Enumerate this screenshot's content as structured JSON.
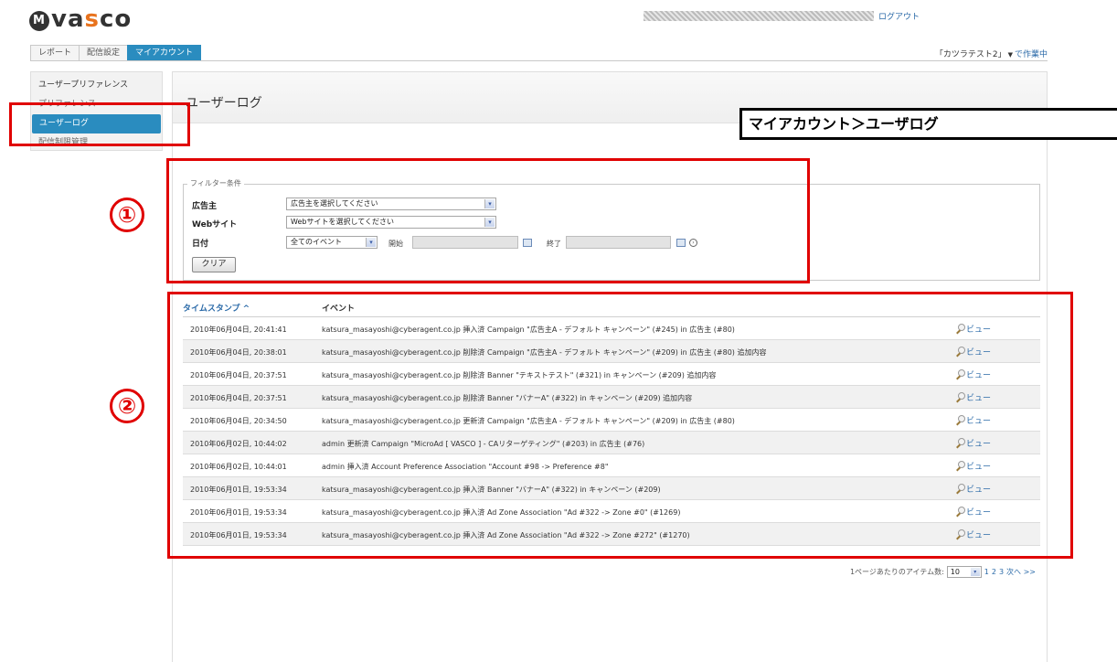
{
  "header": {
    "logo_mark": "M",
    "logo_prefix": "va",
    "logo_accent": "s",
    "logo_suffix": "co",
    "logout": "ログアウト",
    "account_name": "「カツラテスト2」",
    "account_caret": "▼",
    "working_text": "で作業中"
  },
  "tabs": [
    {
      "label": "レポート"
    },
    {
      "label": "配信設定"
    },
    {
      "label": "マイアカウント",
      "active": true
    }
  ],
  "sidebar": {
    "items": [
      {
        "label": "ユーザープリファレンス"
      },
      {
        "label": "プリファレンス"
      },
      {
        "label": "ユーザーログ",
        "active": true
      },
      {
        "label": "配信制限管理"
      }
    ]
  },
  "page": {
    "title": "ユーザーログ",
    "callout": "マイアカウント＞ユーザログ"
  },
  "annotations": {
    "marker_1": "①",
    "marker_2": "②",
    "color": "#e00000"
  },
  "filter": {
    "legend": "フィルター条件",
    "advertiser_label": "広告主",
    "advertiser_value": "広告主を選択してください",
    "website_label": "Webサイト",
    "website_value": "Webサイトを選択してください",
    "date_label": "日付",
    "date_value": "全てのイベント",
    "start_label": "開始",
    "end_label": "終了",
    "clear_button": "クリア",
    "dropdown_glyph": "▾"
  },
  "log": {
    "col_timestamp": "タイムスタンプ ^",
    "col_event": "イベント",
    "view_label": "ビュー",
    "rows": [
      {
        "timestamp": "2010年06月04日, 20:41:41",
        "event": "katsura_masayoshi@cyberagent.co.jp 挿入済 Campaign \"広告主A - デフォルト キャンペーン\" (#245) in 広告主 (#80)"
      },
      {
        "timestamp": "2010年06月04日, 20:38:01",
        "event": "katsura_masayoshi@cyberagent.co.jp 削除済 Campaign \"広告主A - デフォルト キャンペーン\" (#209) in 広告主 (#80) 追加内容"
      },
      {
        "timestamp": "2010年06月04日, 20:37:51",
        "event": "katsura_masayoshi@cyberagent.co.jp 削除済 Banner \"テキストテスト\" (#321) in キャンペーン (#209) 追加内容"
      },
      {
        "timestamp": "2010年06月04日, 20:37:51",
        "event": "katsura_masayoshi@cyberagent.co.jp 削除済 Banner \"バナーA\" (#322) in キャンペーン (#209) 追加内容"
      },
      {
        "timestamp": "2010年06月04日, 20:34:50",
        "event": "katsura_masayoshi@cyberagent.co.jp 更新済 Campaign \"広告主A - デフォルト キャンペーン\" (#209) in 広告主 (#80)"
      },
      {
        "timestamp": "2010年06月02日, 10:44:02",
        "event": "admin 更新済 Campaign \"MicroAd [ VASCO ] - CAリターゲティング\" (#203) in 広告主 (#76)"
      },
      {
        "timestamp": "2010年06月02日, 10:44:01",
        "event": "admin 挿入済 Account Preference Association \"Account #98 -> Preference #8\""
      },
      {
        "timestamp": "2010年06月01日, 19:53:34",
        "event": "katsura_masayoshi@cyberagent.co.jp 挿入済 Banner \"バナーA\" (#322) in キャンペーン (#209)"
      },
      {
        "timestamp": "2010年06月01日, 19:53:34",
        "event": "katsura_masayoshi@cyberagent.co.jp 挿入済 Ad Zone Association \"Ad #322 -> Zone #0\" (#1269)"
      },
      {
        "timestamp": "2010年06月01日, 19:53:34",
        "event": "katsura_masayoshi@cyberagent.co.jp 挿入済 Ad Zone Association \"Ad #322 -> Zone #272\" (#1270)"
      }
    ]
  },
  "pagination": {
    "per_page_label": "1ページあたりのアイテム数:",
    "per_page_value": "10",
    "pages": [
      "1",
      "2",
      "3"
    ],
    "next": "次へ >>"
  }
}
